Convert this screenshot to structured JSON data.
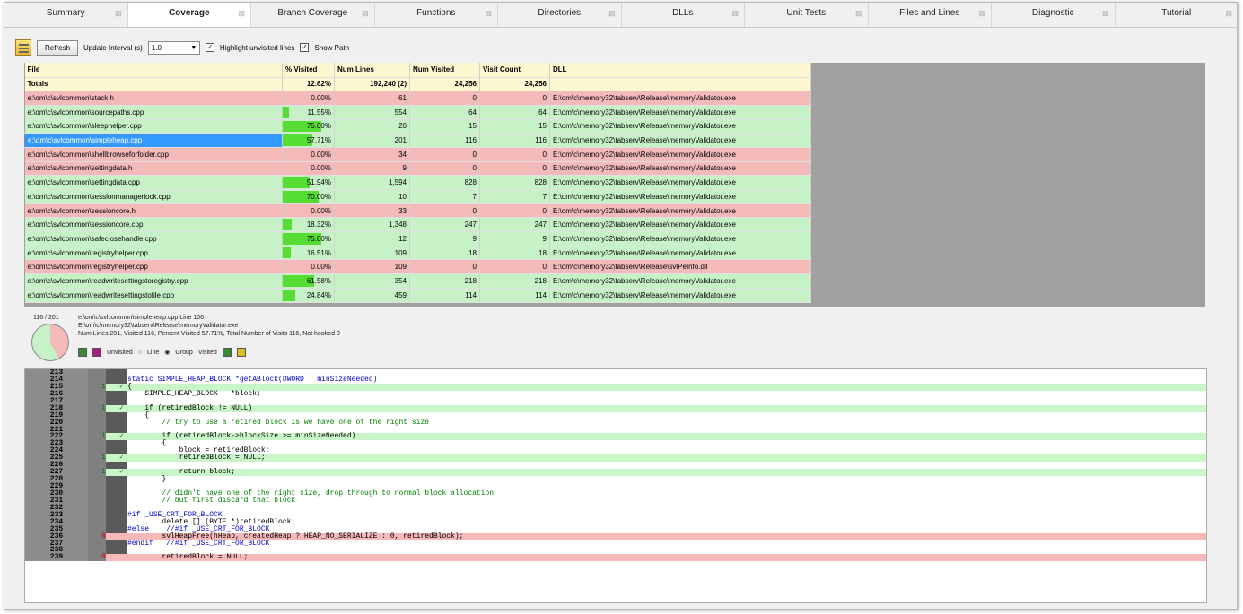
{
  "tabs": [
    "Summary",
    "Coverage",
    "Branch Coverage",
    "Functions",
    "Directories",
    "DLLs",
    "Unit Tests",
    "Files and Lines",
    "Diagnostic",
    "Tutorial"
  ],
  "active_tab": "Coverage",
  "toolbar": {
    "refresh": "Refresh",
    "interval_label": "Update Interval (s)",
    "interval_value": "1.0",
    "highlight": "Highlight unvisited lines",
    "show_path": "Show Path"
  },
  "table": {
    "headers": [
      "File",
      "% Visited",
      "Num Lines",
      "Num Visited",
      "Visit Count",
      "DLL"
    ],
    "totals": [
      "Totals",
      "12.62%",
      "192,240 (2)",
      "24,256",
      "24,256",
      ""
    ],
    "rows": [
      {
        "file": "e:\\om\\c\\svlcommon\\stack.h",
        "pct": 0.0,
        "pct_text": "0.00%",
        "lines": "61",
        "visited": "0",
        "count": "0",
        "dll": "E:\\om\\c\\memory32\\tabserv\\Release\\memoryValidator.exe",
        "status": "red"
      },
      {
        "file": "e:\\om\\c\\svlcommon\\sourcepaths.cpp",
        "pct": 11.55,
        "pct_text": "11.55%",
        "lines": "554",
        "visited": "64",
        "count": "64",
        "dll": "E:\\om\\c\\memory32\\tabserv\\Release\\memoryValidator.exe",
        "status": "green"
      },
      {
        "file": "e:\\om\\c\\svlcommon\\sleephelper.cpp",
        "pct": 75.0,
        "pct_text": "75.00%",
        "lines": "20",
        "visited": "15",
        "count": "15",
        "dll": "E:\\om\\c\\memory32\\tabserv\\Release\\memoryValidator.exe",
        "status": "green"
      },
      {
        "file": "e:\\om\\c\\svlcommon\\simpleheap.cpp",
        "pct": 57.71,
        "pct_text": "57.71%",
        "lines": "201",
        "visited": "116",
        "count": "116",
        "dll": "E:\\om\\c\\memory32\\tabserv\\Release\\memoryValidator.exe",
        "status": "selected"
      },
      {
        "file": "e:\\om\\c\\svlcommon\\shellbrowseforfolder.cpp",
        "pct": 0.0,
        "pct_text": "0.00%",
        "lines": "34",
        "visited": "0",
        "count": "0",
        "dll": "E:\\om\\c\\memory32\\tabserv\\Release\\memoryValidator.exe",
        "status": "red"
      },
      {
        "file": "e:\\om\\c\\svlcommon\\settingdata.h",
        "pct": 0.0,
        "pct_text": "0.00%",
        "lines": "9",
        "visited": "0",
        "count": "0",
        "dll": "E:\\om\\c\\memory32\\tabserv\\Release\\memoryValidator.exe",
        "status": "red"
      },
      {
        "file": "e:\\om\\c\\svlcommon\\settingdata.cpp",
        "pct": 51.94,
        "pct_text": "51.94%",
        "lines": "1,594",
        "visited": "828",
        "count": "828",
        "dll": "E:\\om\\c\\memory32\\tabserv\\Release\\memoryValidator.exe",
        "status": "green"
      },
      {
        "file": "e:\\om\\c\\svlcommon\\sessionmanagerlock.cpp",
        "pct": 70.0,
        "pct_text": "70.00%",
        "lines": "10",
        "visited": "7",
        "count": "7",
        "dll": "E:\\om\\c\\memory32\\tabserv\\Release\\memoryValidator.exe",
        "status": "green"
      },
      {
        "file": "e:\\om\\c\\svlcommon\\sessioncore.h",
        "pct": 0.0,
        "pct_text": "0.00%",
        "lines": "33",
        "visited": "0",
        "count": "0",
        "dll": "E:\\om\\c\\memory32\\tabserv\\Release\\memoryValidator.exe",
        "status": "red"
      },
      {
        "file": "e:\\om\\c\\svlcommon\\sessioncore.cpp",
        "pct": 18.32,
        "pct_text": "18.32%",
        "lines": "1,348",
        "visited": "247",
        "count": "247",
        "dll": "E:\\om\\c\\memory32\\tabserv\\Release\\memoryValidator.exe",
        "status": "green"
      },
      {
        "file": "e:\\om\\c\\svlcommon\\safeclosehandle.cpp",
        "pct": 75.0,
        "pct_text": "75.00%",
        "lines": "12",
        "visited": "9",
        "count": "9",
        "dll": "E:\\om\\c\\memory32\\tabserv\\Release\\memoryValidator.exe",
        "status": "green"
      },
      {
        "file": "e:\\om\\c\\svlcommon\\registryhelper.cpp",
        "pct": 16.51,
        "pct_text": "16.51%",
        "lines": "109",
        "visited": "18",
        "count": "18",
        "dll": "E:\\om\\c\\memory32\\tabserv\\Release\\memoryValidator.exe",
        "status": "green"
      },
      {
        "file": "e:\\om\\c\\svlcommon\\registryhelper.cpp",
        "pct": 0.0,
        "pct_text": "0.00%",
        "lines": "109",
        "visited": "0",
        "count": "0",
        "dll": "E:\\om\\c\\memory32\\tabserv\\Release\\svlPeInfo.dll",
        "status": "red"
      },
      {
        "file": "e:\\om\\c\\svlcommon\\readwritesettingstoregistry.cpp",
        "pct": 61.58,
        "pct_text": "61.58%",
        "lines": "354",
        "visited": "218",
        "count": "218",
        "dll": "E:\\om\\c\\memory32\\tabserv\\Release\\memoryValidator.exe",
        "status": "green"
      },
      {
        "file": "e:\\om\\c\\svlcommon\\readwritesettingstofile.cpp",
        "pct": 24.84,
        "pct_text": "24.84%",
        "lines": "459",
        "visited": "114",
        "count": "114",
        "dll": "E:\\om\\c\\memory32\\tabserv\\Release\\memoryValidator.exe",
        "status": "green"
      }
    ]
  },
  "detail": {
    "ratio": "116 / 201",
    "visited_fraction": 0.5771,
    "line1": "e:\\om\\c\\svlcommon\\simpleheap.cpp Line 106",
    "line2": "E:\\om\\c\\memory32\\tabserv\\Release\\memoryValidator.exe",
    "line3": "Num Lines  201, Visited  116, Percent Visited 57.71%, Total Number of Visits  116, Not hooked 0",
    "unvisited": "Unvisited",
    "opt_line": "Line",
    "opt_group": "Group",
    "visited": "Visited"
  },
  "code": [
    {
      "n": "213",
      "c": "",
      "s": "",
      "t": "",
      "k": ""
    },
    {
      "n": "214",
      "c": "",
      "s": "",
      "t": "static SIMPLE_HEAP_BLOCK *getABlock(DWORD   minSizeNeeded)",
      "k": "kw"
    },
    {
      "n": "215",
      "c": "1",
      "s": "v",
      "t": "{",
      "k": ""
    },
    {
      "n": "216",
      "c": "",
      "s": "",
      "t": "    SIMPLE_HEAP_BLOCK   *block;",
      "k": ""
    },
    {
      "n": "217",
      "c": "",
      "s": "",
      "t": "",
      "k": ""
    },
    {
      "n": "218",
      "c": "1",
      "s": "v",
      "t": "    if (retiredBlock != NULL)",
      "k": ""
    },
    {
      "n": "219",
      "c": "",
      "s": "",
      "t": "    {",
      "k": ""
    },
    {
      "n": "220",
      "c": "",
      "s": "",
      "t": "        // try to use a retired block is we have one of the right size",
      "k": "cm"
    },
    {
      "n": "221",
      "c": "",
      "s": "",
      "t": "",
      "k": ""
    },
    {
      "n": "222",
      "c": "1",
      "s": "v",
      "t": "        if (retiredBlock->blockSize >= minSizeNeeded)",
      "k": ""
    },
    {
      "n": "223",
      "c": "",
      "s": "",
      "t": "        {",
      "k": ""
    },
    {
      "n": "224",
      "c": "",
      "s": "",
      "t": "            block = retiredBlock;",
      "k": ""
    },
    {
      "n": "225",
      "c": "1",
      "s": "v",
      "t": "            retiredBlock = NULL;",
      "k": ""
    },
    {
      "n": "226",
      "c": "",
      "s": "",
      "t": "",
      "k": ""
    },
    {
      "n": "227",
      "c": "1",
      "s": "v",
      "t": "            return block;",
      "k": ""
    },
    {
      "n": "228",
      "c": "",
      "s": "",
      "t": "        }",
      "k": ""
    },
    {
      "n": "229",
      "c": "",
      "s": "",
      "t": "",
      "k": ""
    },
    {
      "n": "230",
      "c": "",
      "s": "",
      "t": "        // didn't have one of the right size, drop through to normal block allocation",
      "k": "cm"
    },
    {
      "n": "231",
      "c": "",
      "s": "",
      "t": "        // but first discard that block",
      "k": "cm"
    },
    {
      "n": "232",
      "c": "",
      "s": "",
      "t": "",
      "k": ""
    },
    {
      "n": "233",
      "c": "",
      "s": "",
      "t": "#if _USE_CRT_FOR_BLOCK",
      "k": "kw"
    },
    {
      "n": "234",
      "c": "",
      "s": "",
      "t": "        delete [] (BYTE *)retiredBlock;",
      "k": ""
    },
    {
      "n": "235",
      "c": "",
      "s": "",
      "t": "#else    //#if _USE_CRT_FOR_BLOCK",
      "k": "kw"
    },
    {
      "n": "236",
      "c": "0",
      "s": "u",
      "t": "        svlHeapFree(hHeap, createdHeap ? HEAP_NO_SERIALIZE : 0, retiredBlock);",
      "k": ""
    },
    {
      "n": "237",
      "c": "",
      "s": "",
      "t": "#endif   //#if _USE_CRT_FOR_BLOCK",
      "k": "kw"
    },
    {
      "n": "238",
      "c": "",
      "s": "",
      "t": "",
      "k": ""
    },
    {
      "n": "239",
      "c": "0",
      "s": "u",
      "t": "        retiredBlock = NULL;",
      "k": ""
    }
  ],
  "colors": {
    "visited": "#c7f2c7",
    "unvisited": "#f4b9b9",
    "bar": "#55dd33",
    "selected": "#3399ff",
    "header": "#fdf8d2"
  }
}
